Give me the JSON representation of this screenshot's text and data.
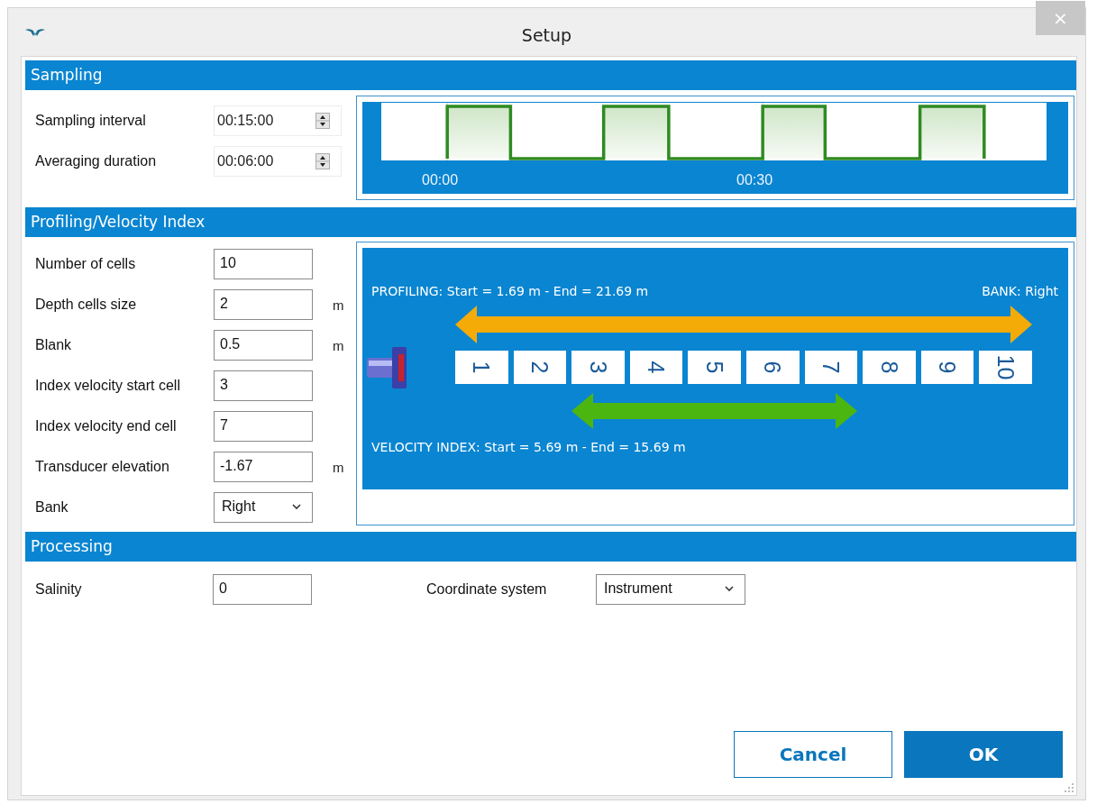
{
  "window": {
    "title": "Setup",
    "close_glyph": "×"
  },
  "sampling": {
    "title": "Sampling",
    "fields": [
      {
        "label": "Sampling interval",
        "value": "00:15:00"
      },
      {
        "label": "Averaging duration",
        "value": "00:06:00"
      }
    ],
    "timeline": {
      "tick_labels": [
        "00:00",
        "00:30"
      ]
    }
  },
  "profiling": {
    "title": "Profiling/Velocity Index",
    "fields": [
      {
        "kind": "text",
        "label": "Number of cells",
        "value": "10"
      },
      {
        "kind": "text",
        "label": "Depth cells size",
        "value": "2",
        "unit": "m"
      },
      {
        "kind": "text",
        "label": "Blank",
        "value": "0.5",
        "unit": "m"
      },
      {
        "kind": "text",
        "label": "Index velocity start cell",
        "value": "3"
      },
      {
        "kind": "text",
        "label": "Index velocity end cell",
        "value": "7"
      },
      {
        "kind": "text",
        "label": "Transducer elevation",
        "value": "-1.67",
        "unit": "m"
      },
      {
        "kind": "select",
        "label": "Bank",
        "value": "Right"
      }
    ],
    "diagram": {
      "profiling_label": "PROFILING: Start = 1.69 m - End = 21.69 m",
      "bank_label": "BANK: Right",
      "cells": [
        "1",
        "2",
        "3",
        "4",
        "5",
        "6",
        "7",
        "8",
        "9",
        "10"
      ],
      "velocity_label": "VELOCITY INDEX: Start = 5.69 m - End = 15.69 m"
    }
  },
  "processing": {
    "title": "Processing",
    "fields": [
      {
        "kind": "text",
        "label": "Salinity",
        "value": "0"
      },
      {
        "kind": "select",
        "label": "Coordinate system",
        "value": "Instrument"
      }
    ]
  },
  "buttons": [
    {
      "label": "Cancel",
      "kind": "secondary"
    },
    {
      "label": "OK",
      "kind": "primary"
    }
  ]
}
